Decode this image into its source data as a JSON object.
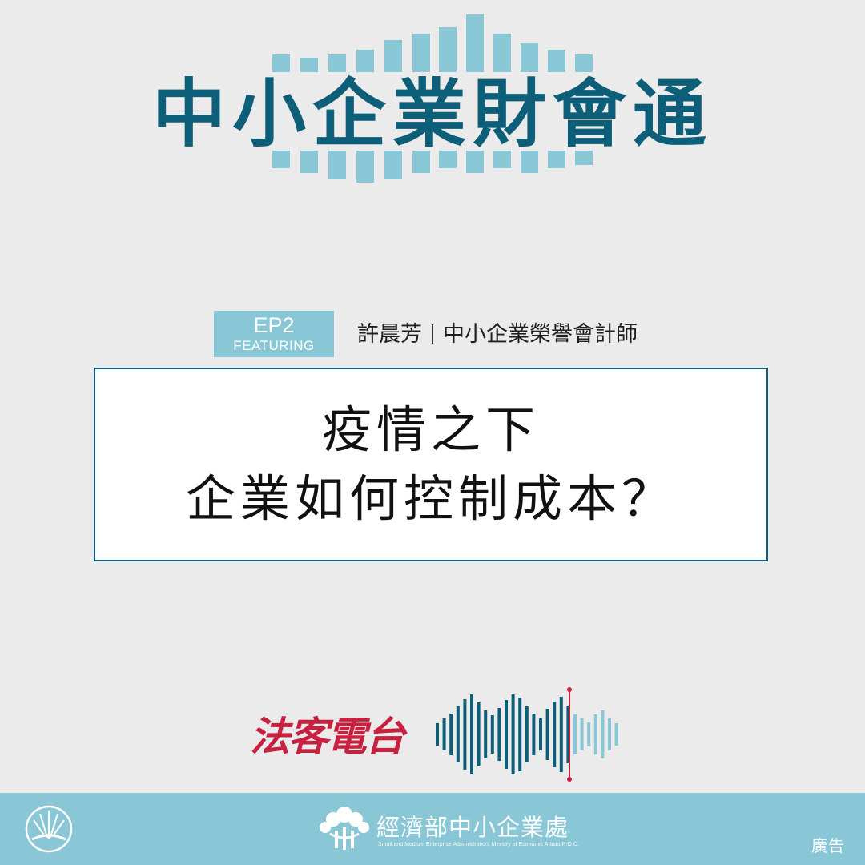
{
  "header": {
    "title": "中小企業財會通"
  },
  "episode": {
    "number": "EP2",
    "featuring": "FEATURING"
  },
  "guest": {
    "name": "許晨芳",
    "title": "中小企業榮譽會計師"
  },
  "question": {
    "line1": "疫情之下",
    "line2": "企業如何控制成本？"
  },
  "brand": {
    "name": "法客電台"
  },
  "footer": {
    "ministry_name": "經濟部中小企業處",
    "ministry_english": "Small and Medium Enterprise Administration, Ministry of Economic Affairs R.O.C.",
    "ad_label": "廣告"
  },
  "colors": {
    "background": "#ebebeb",
    "title_navy": "#0d5e78",
    "accent_light_blue": "#8ac7d6",
    "brand_red": "#c8203f",
    "footer_blue": "#8ac7d6"
  }
}
